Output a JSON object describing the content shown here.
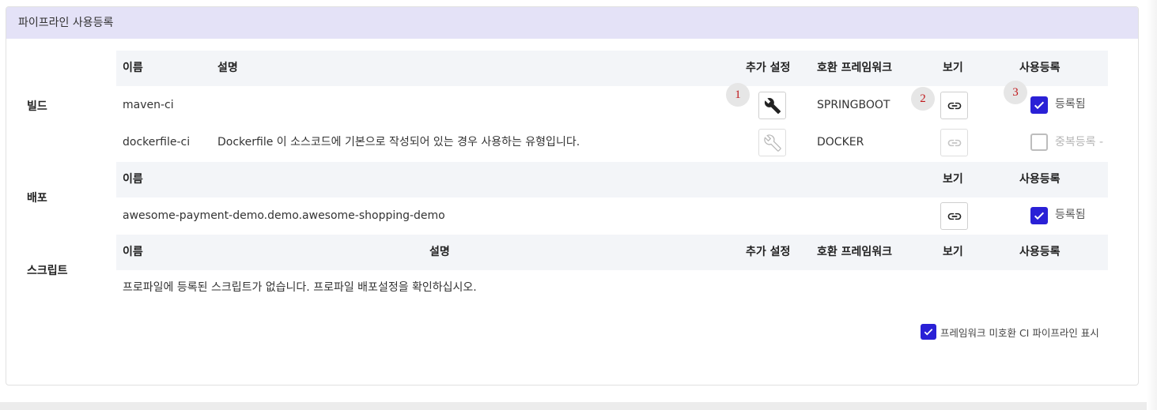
{
  "panel": {
    "title": "파이프라인 사용등록"
  },
  "build": {
    "section_label": "빌드",
    "headers": {
      "name": "이름",
      "desc": "설명",
      "extra": "추가 설정",
      "framework": "호환 프레임워크",
      "view": "보기",
      "register": "사용등록"
    },
    "rows": [
      {
        "name": "maven-ci",
        "desc": "",
        "framework": "SPRINGBOOT",
        "register_label": "등록됨",
        "registered": true,
        "enabled": true
      },
      {
        "name": "dockerfile-ci",
        "desc": "Dockerfile 이 소스코드에 기본으로 작성되어 있는 경우 사용하는 유형입니다.",
        "framework": "DOCKER",
        "register_label": "중복등록 -",
        "registered": false,
        "enabled": false
      }
    ]
  },
  "deploy": {
    "section_label": "배포",
    "headers": {
      "name": "이름",
      "view": "보기",
      "register": "사용등록"
    },
    "rows": [
      {
        "name": "awesome-payment-demo.demo.awesome-shopping-demo",
        "register_label": "등록됨",
        "registered": true
      }
    ]
  },
  "script": {
    "section_label": "스크립트",
    "headers": {
      "name": "이름",
      "desc": "설명",
      "extra": "추가 설정",
      "framework": "호환 프레임워크",
      "view": "보기",
      "register": "사용등록"
    },
    "empty_message": "프로파일에 등록된 스크립트가 없습니다. 프로파일 배포설정을 확인하십시오."
  },
  "footer": {
    "show_incompatible_label": "프레임워크 미호환 CI 파이프라인 표시",
    "show_incompatible_checked": true
  },
  "annotations": {
    "badge1": "1",
    "badge2": "2",
    "badge3": "3"
  },
  "colors": {
    "header_bg": "#e4e2f7",
    "table_head_bg": "#f3f5f8",
    "checkbox_on": "#2a20d6",
    "badge_text": "#c0181b"
  }
}
